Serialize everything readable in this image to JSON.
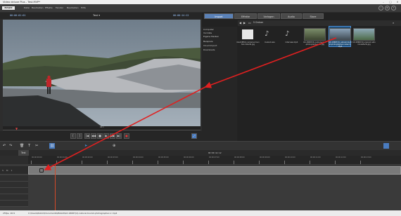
{
  "window": {
    "title": "Video deluxe Plus - Test.MVP*"
  },
  "menu": {
    "logo": "MAGIX",
    "items": [
      "Datei",
      "Bearbeiten",
      "Effekte",
      "Fenster",
      "Bearbeiten",
      "Hilfe"
    ]
  },
  "preview": {
    "timecode_left": "00:00:01:01",
    "project": "Test",
    "timecode_right": "00:00:14:12",
    "ruler_mark": "00:1"
  },
  "media": {
    "tabs": [
      "Import",
      "Effekte",
      "Vorlagen",
      "Audio",
      "Store"
    ],
    "active_tab": "Import",
    "folder": "5 Ordner",
    "nav": [
      "Computer",
      "Vorrräte",
      "Eigene Medien",
      "Beispiele",
      "Cloud Import",
      "Downloads"
    ],
    "items": [
      {
        "label": "iGLACIER-0-camera-mountain-hikerbl.jpg",
        "kind": "file"
      },
      {
        "label": "Iceland.wav",
        "kind": "audio"
      },
      {
        "label": "Interview.mp4",
        "kind": "audio"
      },
      {
        "label": "bit-18687(8)-camera-man-photographer-hill.jpg",
        "kind": "thumb"
      },
      {
        "label": "bit-18687(6)-camera-icelandic-tourist.jpg",
        "kind": "thumb"
      },
      {
        "label": "bit-18687(2)-natural-tourist-photographer-iceland-.mp4",
        "kind": "thumb",
        "selected": true
      },
      {
        "label": "bit-18687(4)-iceland-natural-waterfa.jpg",
        "kind": "thumb"
      }
    ]
  },
  "timeline": {
    "project": "Test",
    "ruler_top": "00:00:14:12",
    "ruler_ticks": [
      "00:00:00:00",
      "00:00:01:00",
      "00:00:02:00",
      "00:00:03:00",
      "00:00:04:00",
      "00:00:05:00",
      "00:00:06:00",
      "00:00:07:00",
      "00:00:08:00",
      "00:00:09:00",
      "00:00:10:00",
      "00:00:11:00",
      "00:00:12:00",
      "00:00:13:00"
    ],
    "track_labels": [
      "S",
      "M",
      "1"
    ]
  },
  "status": {
    "text": "C:\\Users\\Public\\Documents\\MAGIX\\bit-18687(2)-natural-tourist-photographer-ic.mp4",
    "fps": "25fps, 16:9"
  }
}
